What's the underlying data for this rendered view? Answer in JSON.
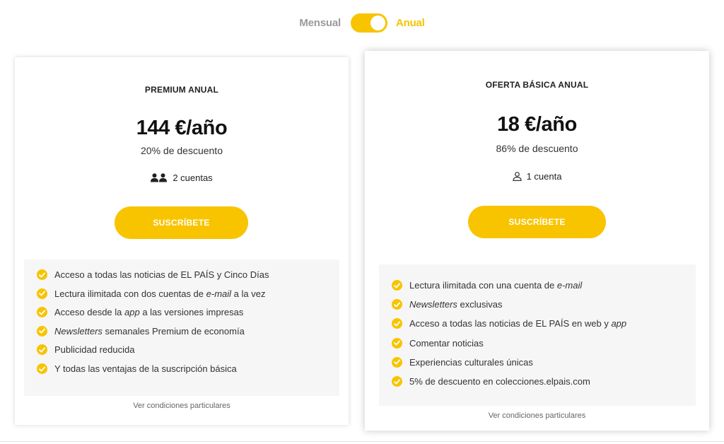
{
  "toggle": {
    "monthly_label": "Mensual",
    "annual_label": "Anual",
    "selected": "Anual"
  },
  "colors": {
    "accent": "#f8c400",
    "feature_bg": "#f7f6f6",
    "muted_text": "#9a9a9a"
  },
  "plans": [
    {
      "name": "PREMIUM ANUAL",
      "price": "144 €/año",
      "discount": "20% de descuento",
      "accounts": "2 cuentas",
      "accounts_icon": "two-users-icon",
      "button": "SUSCRÍBETE",
      "features": [
        {
          "parts": [
            {
              "t": "Acceso a todas las noticias de EL PAÍS y Cinco Días",
              "i": false
            }
          ]
        },
        {
          "parts": [
            {
              "t": "Lectura ilimitada con dos cuentas de ",
              "i": false
            },
            {
              "t": "e-mail",
              "i": true
            },
            {
              "t": " a la vez",
              "i": false
            }
          ]
        },
        {
          "parts": [
            {
              "t": "Acceso desde la ",
              "i": false
            },
            {
              "t": "app",
              "i": true
            },
            {
              "t": " a las versiones impresas",
              "i": false
            }
          ]
        },
        {
          "parts": [
            {
              "t": "Newsletters",
              "i": true
            },
            {
              "t": " semanales Premium de economía",
              "i": false
            }
          ]
        },
        {
          "parts": [
            {
              "t": "Publicidad reducida",
              "i": false
            }
          ]
        },
        {
          "parts": [
            {
              "t": "Y todas las ventajas de la suscripción básica",
              "i": false
            }
          ]
        }
      ],
      "conditions": "Ver condiciones particulares"
    },
    {
      "name": "OFERTA BÁSICA ANUAL",
      "price": "18 €/año",
      "discount": "86% de descuento",
      "accounts": "1 cuenta",
      "accounts_icon": "user-icon",
      "button": "SUSCRÍBETE",
      "features": [
        {
          "parts": [
            {
              "t": "Lectura ilimitada con una cuenta de ",
              "i": false
            },
            {
              "t": "e-mail",
              "i": true
            }
          ]
        },
        {
          "parts": [
            {
              "t": "Newsletters",
              "i": true
            },
            {
              "t": " exclusivas",
              "i": false
            }
          ]
        },
        {
          "parts": [
            {
              "t": "Acceso a todas las noticias de EL PAÍS en web y ",
              "i": false
            },
            {
              "t": "app",
              "i": true
            }
          ]
        },
        {
          "parts": [
            {
              "t": "Comentar noticias",
              "i": false
            }
          ]
        },
        {
          "parts": [
            {
              "t": "Experiencias culturales únicas",
              "i": false
            }
          ]
        },
        {
          "parts": [
            {
              "t": "5% de descuento en colecciones.elpais.com",
              "i": false
            }
          ]
        }
      ],
      "conditions": "Ver condiciones particulares"
    }
  ]
}
